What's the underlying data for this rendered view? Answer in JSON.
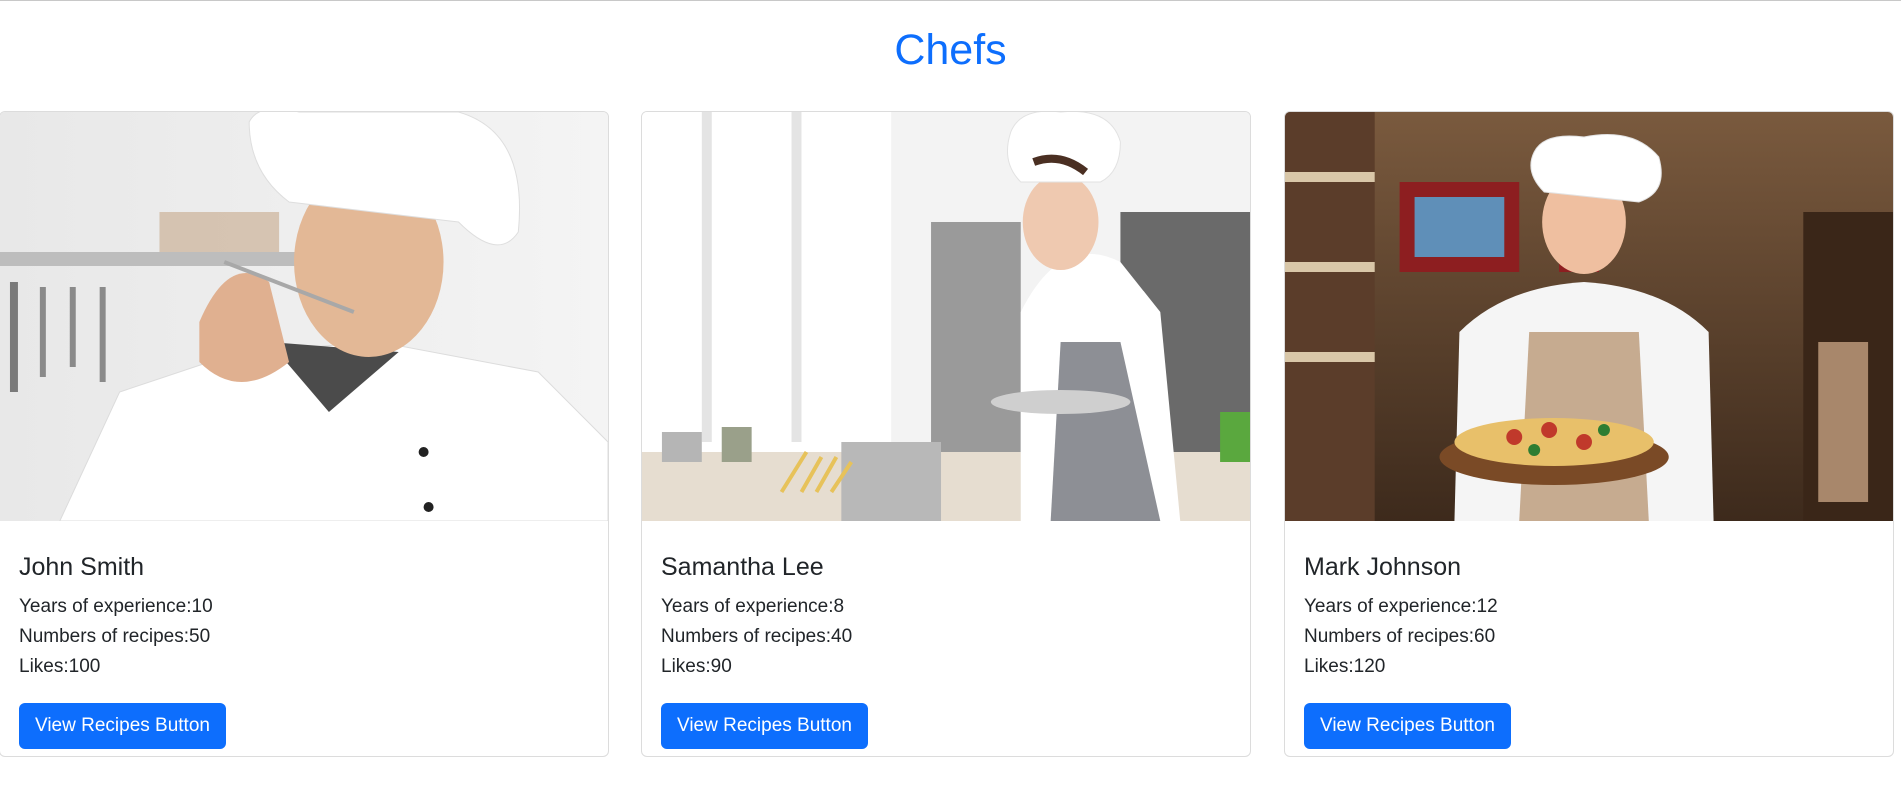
{
  "page": {
    "title": "Chefs"
  },
  "colors": {
    "accent": "#0d6efd",
    "card_border": "#dcdcdc",
    "text": "#212529"
  },
  "chefs": [
    {
      "name": "John Smith",
      "experience": "Years of experience:10",
      "recipes": "Numbers of recipes:50",
      "likes": "Likes:100",
      "button_label": "View Recipes Button"
    },
    {
      "name": "Samantha Lee",
      "experience": "Years of experience:8",
      "recipes": "Numbers of recipes:40",
      "likes": "Likes:90",
      "button_label": "View Recipes Button"
    },
    {
      "name": "Mark Johnson",
      "experience": "Years of experience:12",
      "recipes": "Numbers of recipes:60",
      "likes": "Likes:120",
      "button_label": "View Recipes Button"
    }
  ]
}
